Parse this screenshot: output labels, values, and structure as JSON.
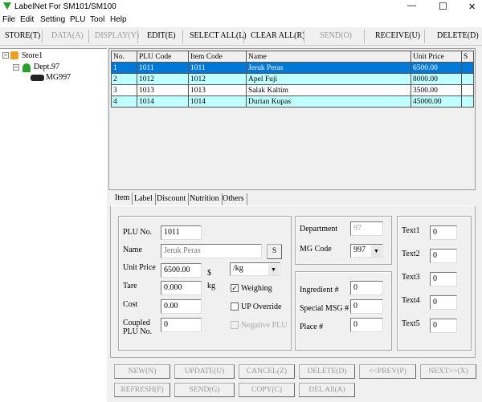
{
  "window": {
    "title": "LabelNet For SM101/SM100",
    "minimize": "—",
    "maximize": "☐",
    "close": "✕"
  },
  "menu": [
    "File",
    "Edit",
    "Setting",
    "PLU",
    "Tool",
    "Help"
  ],
  "toolbar": {
    "store": "STORE(T)",
    "data": "DATA(A)",
    "display": "DISPLAY(Y)",
    "edit": "EDIT(E)",
    "select_all": "SELECT ALL(L)",
    "clear_all": "CLEAR ALL(R)",
    "send": "SEND(O)",
    "receive": "RECEIVE(U)",
    "delete": "DELETE(D)"
  },
  "tree": {
    "store": "Store1",
    "dept": "Dept.97",
    "mg": "MG997"
  },
  "table": {
    "headers": [
      "No.",
      "PLU Code",
      "Item Code",
      "Name",
      "Unit Price",
      "S"
    ],
    "rows": [
      [
        "1",
        "1011",
        "1011",
        "Jeruk Peras",
        "6500.00",
        ""
      ],
      [
        "2",
        "1012",
        "1012",
        "Apel Fuji",
        "8000.00",
        ""
      ],
      [
        "3",
        "1013",
        "1013",
        "Salak Kaltim",
        "3500.00",
        ""
      ],
      [
        "4",
        "1014",
        "1014",
        "Durian Kupas",
        "45000.00",
        ""
      ]
    ]
  },
  "tabs": [
    "Item",
    "Label",
    "Discount",
    "Nutrition",
    "Others"
  ],
  "form": {
    "plu_no_label": "PLU No.",
    "plu_no": "1011",
    "name_label": "Name",
    "name": "Jeruk Peras",
    "s_button": "S",
    "unit_price_label": "Unit Price",
    "unit_price": "6500.00",
    "currency": "$",
    "unit": "/kg",
    "tare_label": "Tare",
    "tare": "0.000",
    "tare_unit": "kg",
    "cost_label": "Cost",
    "cost": "0.00",
    "coupled_label_1": "Coupled",
    "coupled_label_2": "PLU No.",
    "coupled": "0",
    "weighing": "Weighing",
    "up_override": "UP Override",
    "negative_plu": "Negative PLU",
    "department_label": "Department",
    "department": "97",
    "mg_code_label": "MG Code",
    "mg_code": "997",
    "ingredient_label": "Ingredient #",
    "ingredient": "0",
    "special_msg_label": "Special MSG #",
    "special_msg": "0",
    "place_label": "Place #",
    "place": "0",
    "texts": [
      {
        "label": "Text1",
        "value": "0"
      },
      {
        "label": "Text2",
        "value": "0"
      },
      {
        "label": "Text3",
        "value": "0"
      },
      {
        "label": "Text4",
        "value": "0"
      },
      {
        "label": "Text5",
        "value": "0"
      }
    ]
  },
  "buttons": {
    "new": "NEW(N)",
    "update": "UPDATE(U)",
    "cancel": "CANCEL(Z)",
    "delete": "DELETE(D)",
    "prev": "<<PREV(P)",
    "next": "NEXT>>(X)",
    "refresh": "REFRESH(F)",
    "send": "SEND(G)",
    "copy": "COPY(C)",
    "del_all": "DEL All(A)"
  }
}
